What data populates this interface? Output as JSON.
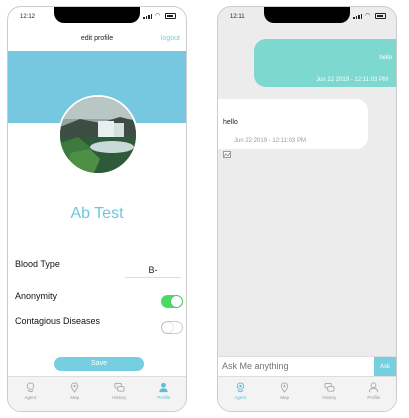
{
  "left_screen": {
    "status_time": "12:12",
    "title": "edit profile",
    "logout": "logout",
    "name": "Ab  Test",
    "blood_type_label": "Blood Type",
    "blood_type_value": "B-",
    "anonymity_label": "Anonymity",
    "anonymity_on": true,
    "contagious_label": "Contagious Diseases",
    "contagious_on": false,
    "save": "Save",
    "tabs": [
      {
        "label": "Agent",
        "icon": "person-pin-icon"
      },
      {
        "label": "Map",
        "icon": "map-pin-icon"
      },
      {
        "label": "History",
        "icon": "chat-bubbles-icon"
      },
      {
        "label": "Profile",
        "icon": "person-icon"
      }
    ],
    "active_tab": "Profile"
  },
  "right_screen": {
    "status_time": "12:11",
    "outgoing": {
      "text": "hello",
      "timestamp": "Jun 22 2019 - 12:11:03 PM"
    },
    "incoming": {
      "text": "hello",
      "timestamp": "Jun 22 2019 - 12:11:03 PM"
    },
    "input_placeholder": "Ask Me anything",
    "ask": "Ask",
    "tabs": [
      {
        "label": "Agent",
        "icon": "person-pin-icon"
      },
      {
        "label": "Map",
        "icon": "map-pin-icon"
      },
      {
        "label": "History",
        "icon": "chat-bubbles-icon"
      },
      {
        "label": "Profile",
        "icon": "person-icon"
      }
    ],
    "active_tab": "Agent"
  },
  "colors": {
    "accent": "#76cfe0",
    "bubble_out": "#7dd8cf",
    "toggle_on": "#4cd964"
  }
}
